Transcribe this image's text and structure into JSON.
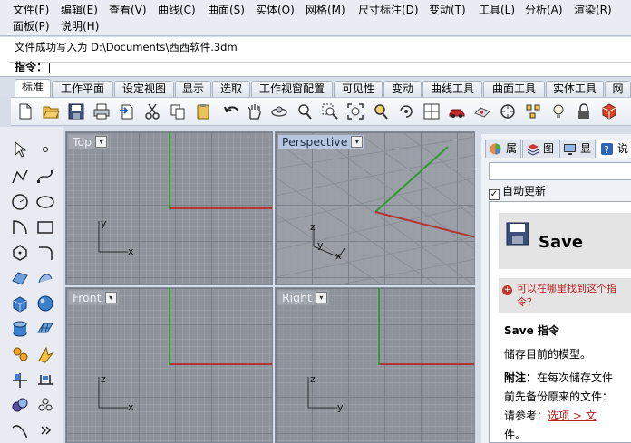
{
  "menu": [
    "文件(F)",
    "编辑(E)",
    "查看(V)",
    "曲线(C)",
    "曲面(S)",
    "实体(O)",
    "网格(M)",
    "尺寸标注(D)",
    "变动(T)",
    "工具(L)",
    "分析(A)",
    "渲染(R)",
    "面板(P)",
    "说明(H)"
  ],
  "command": {
    "history": "文件成功写入为 D:\\Documents\\西西软件.3dm",
    "prompt": "指令："
  },
  "tabs": [
    {
      "label": "标准",
      "active": true
    },
    {
      "label": "工作平面"
    },
    {
      "label": "设定视图"
    },
    {
      "label": "显示"
    },
    {
      "label": "选取"
    },
    {
      "label": "工作视窗配置"
    },
    {
      "label": "可见性"
    },
    {
      "label": "变动"
    },
    {
      "label": "曲线工具"
    },
    {
      "label": "曲面工具"
    },
    {
      "label": "实体工具"
    },
    {
      "label": "网"
    }
  ],
  "toolbar_icons": [
    "new-file",
    "open-folder",
    "save",
    "print",
    "import",
    "cut",
    "copy",
    "paste",
    "undo",
    "pan-hand",
    "rotate-view",
    "zoom",
    "zoom-window",
    "zoom-extents",
    "zoom-selected",
    "zoom-target",
    "four-viewports",
    "car-render",
    "render-preview",
    "circle-select",
    "select-points",
    "light-bulb",
    "lock",
    "shade"
  ],
  "left_tools": [
    "select-arrow",
    "point",
    "polyline",
    "curve-points",
    "circle",
    "ellipse",
    "arc",
    "rectangle",
    "polygon",
    "fillet",
    "surface-edge",
    "patch",
    "box",
    "sphere",
    "cylinder",
    "mesh",
    "explode",
    "boolean",
    "transform-move",
    "dimension",
    "analyze",
    "curvature",
    "freeform-curve",
    "more"
  ],
  "viewports": [
    {
      "title": "Top",
      "active": false,
      "x_label": "x",
      "y_label": "y"
    },
    {
      "title": "Perspective",
      "active": true,
      "x_label": "x",
      "y_label": "y",
      "z_label": "z"
    },
    {
      "title": "Front",
      "active": false,
      "x_label": "x",
      "y_label": "z"
    },
    {
      "title": "Right",
      "active": false,
      "x_label": "y",
      "y_label": "z"
    }
  ],
  "dropdown_glyph": "▾",
  "panel": {
    "tabs": [
      "属",
      "图",
      "显",
      "说"
    ],
    "auto_update_label": "自动更新",
    "auto_update_checked": true,
    "check_mark": "✓",
    "doc": {
      "title": "Save",
      "find_text": "可以在哪里找到这个指令？",
      "heading": "Save 指令",
      "desc": "储存目前的模型。",
      "note_bold": "附注：",
      "note_line1": "在每次储存文件",
      "note_line2": "前先备份原来的文件：",
      "note_line3": "请参考：",
      "note_link": "选项 > 文",
      "note_line4": "件。"
    }
  },
  "colors": {
    "axis_x": "#b23535",
    "axis_y": "#2f9b2f",
    "active_tab": "#ffffff"
  }
}
